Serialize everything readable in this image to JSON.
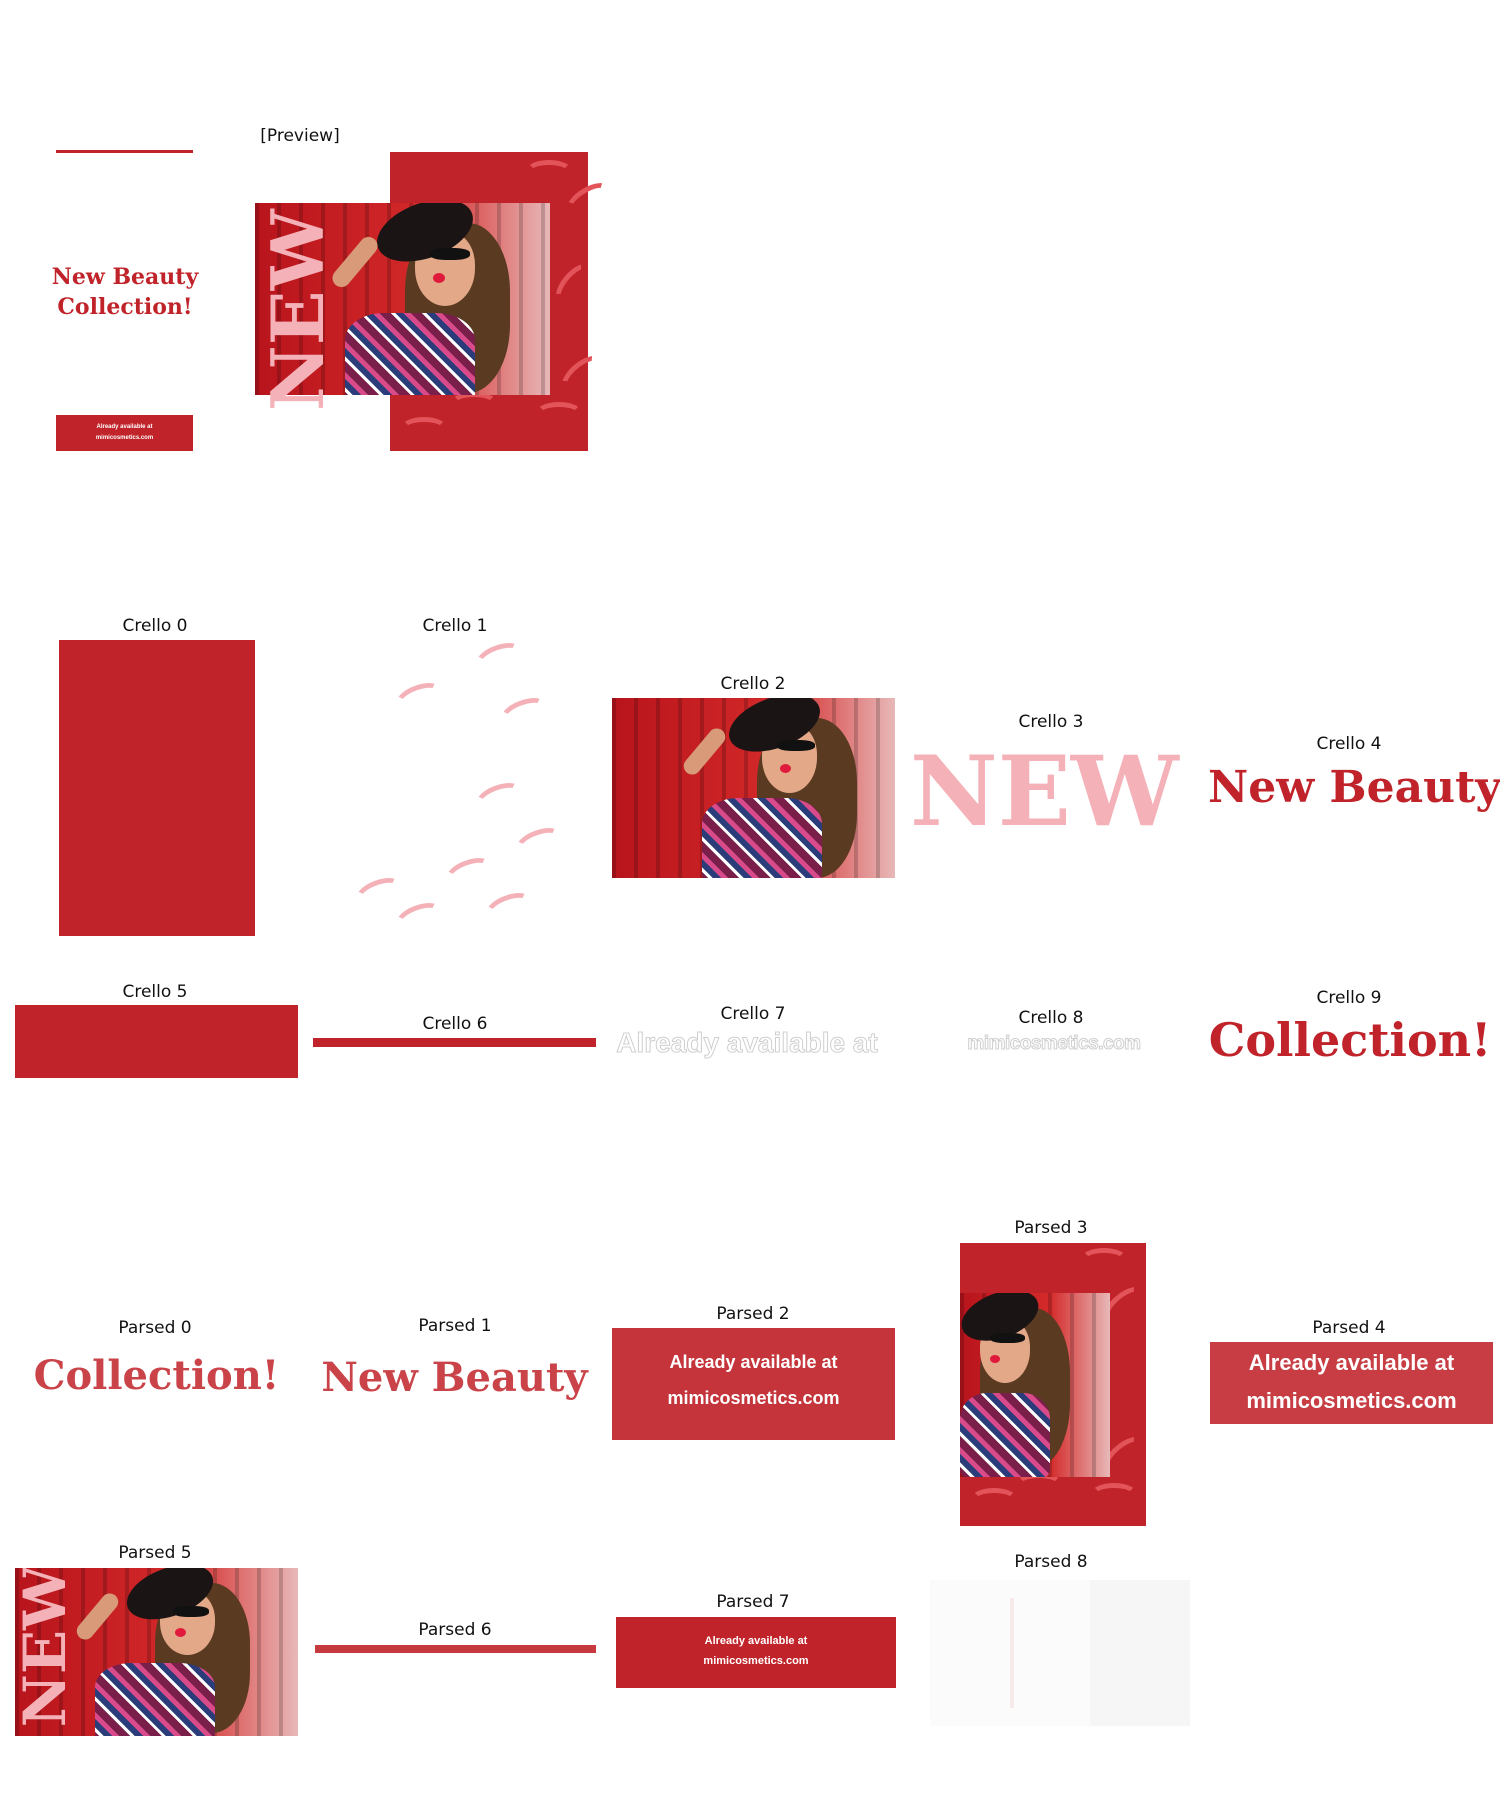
{
  "captions": {
    "preview": "[Preview]",
    "crello": [
      "Crello 0",
      "Crello 1",
      "Crello 2",
      "Crello 3",
      "Crello 4",
      "Crello 5",
      "Crello 6",
      "Crello 7",
      "Crello 8",
      "Crello 9"
    ],
    "parsed": [
      "Parsed 0",
      "Parsed 1",
      "Parsed 2",
      "Parsed 3",
      "Parsed 4",
      "Parsed 5",
      "Parsed 6",
      "Parsed 7",
      "Parsed 8"
    ]
  },
  "design": {
    "headline_line1": "New Beauty",
    "headline_line2": "Collection!",
    "vertical_word": "NEW",
    "cta_line1": "Already available at",
    "cta_line2": "mimicosmetics.com"
  },
  "parsed_text": {
    "cta_line1": "Already available at",
    "cta_line2": "mimicosmetics.com"
  },
  "colors": {
    "brand_red": "#c0232a",
    "pink": "#f4b2b8",
    "white": "#ffffff"
  }
}
